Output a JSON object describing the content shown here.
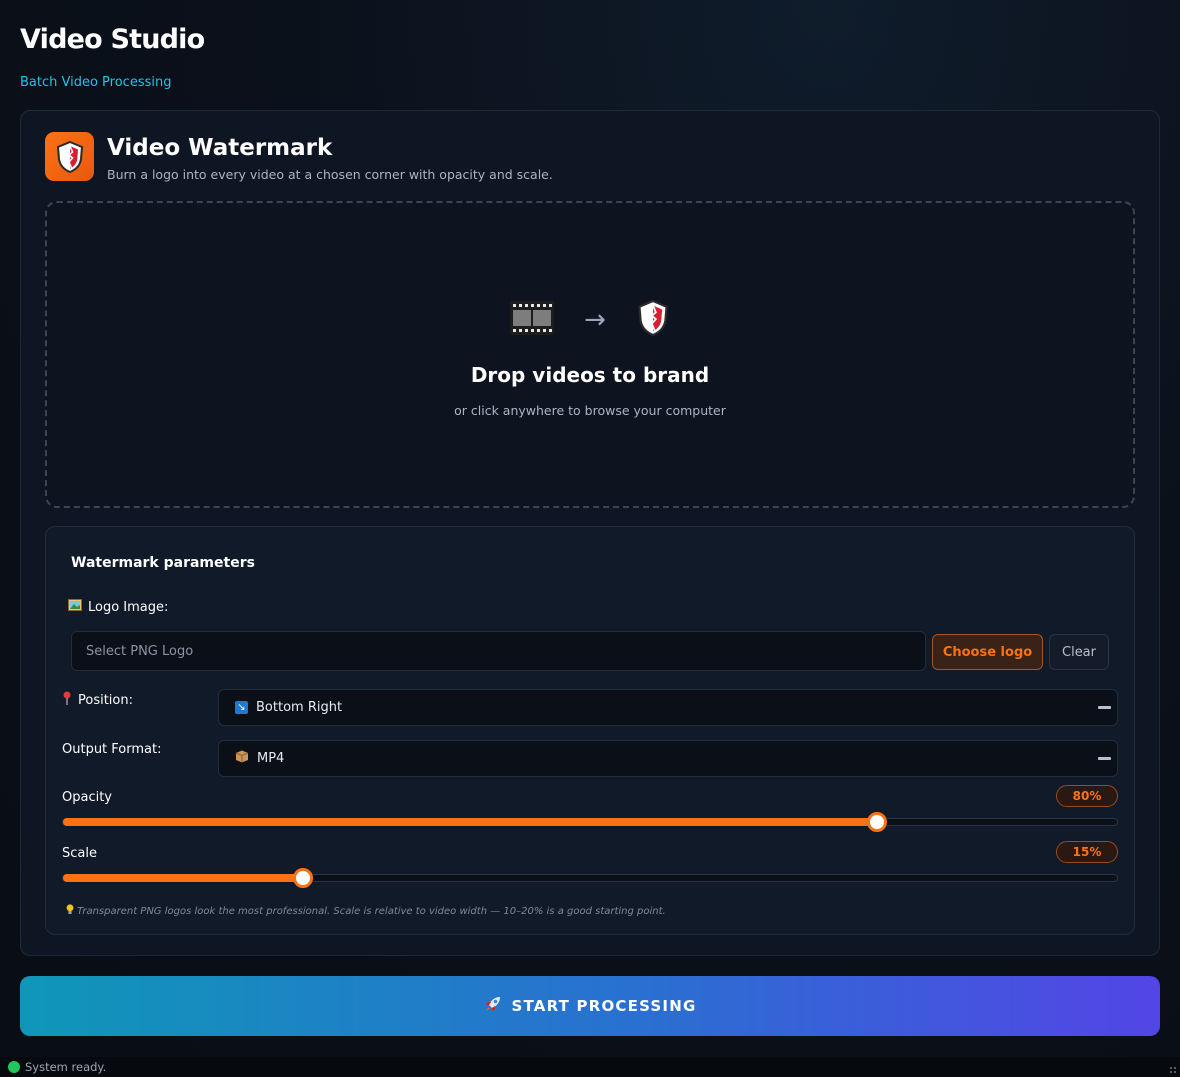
{
  "app": {
    "title": "Video Studio",
    "subtitle": "Batch Video Processing"
  },
  "tool": {
    "icon": "shield-icon",
    "title": "Video Watermark",
    "description": "Burn a logo into every video at a chosen corner with opacity and scale."
  },
  "dropzone": {
    "icons": [
      "film-strip-icon",
      "arrow-right-icon",
      "shield-icon"
    ],
    "arrow": "→",
    "title": "Drop videos to brand",
    "subtitle": "or click anywhere to browse your computer"
  },
  "params": {
    "title": "Watermark parameters",
    "logo": {
      "label": "Logo Image:",
      "icon": "picture-icon",
      "placeholder": "Select PNG Logo",
      "choose_label": "Choose logo",
      "clear_label": "Clear"
    },
    "position": {
      "label": "Position:",
      "icon": "pushpin-icon",
      "value": "Bottom Right",
      "value_icon": "arrow-down-right-icon"
    },
    "output_format": {
      "label": "Output Format:",
      "value": "MP4",
      "value_icon": "package-icon"
    },
    "opacity": {
      "label": "Opacity",
      "value_text": "80%",
      "fraction": 0.772
    },
    "scale": {
      "label": "Scale",
      "value_text": "15%",
      "fraction": 0.228
    },
    "hint": "Transparent PNG logos look the most professional. Scale is relative to video width — 10–20% is a good starting point.",
    "hint_icon": "lightbulb-icon"
  },
  "start_button": {
    "label": "START PROCESSING",
    "icon": "rocket-icon"
  },
  "status": {
    "text": "System ready.",
    "color": "#22c55e"
  },
  "colors": {
    "accent": "#f97316",
    "link": "#22c3e6",
    "button_gradient_start": "#0f97b8",
    "button_gradient_end": "#5345e6"
  }
}
